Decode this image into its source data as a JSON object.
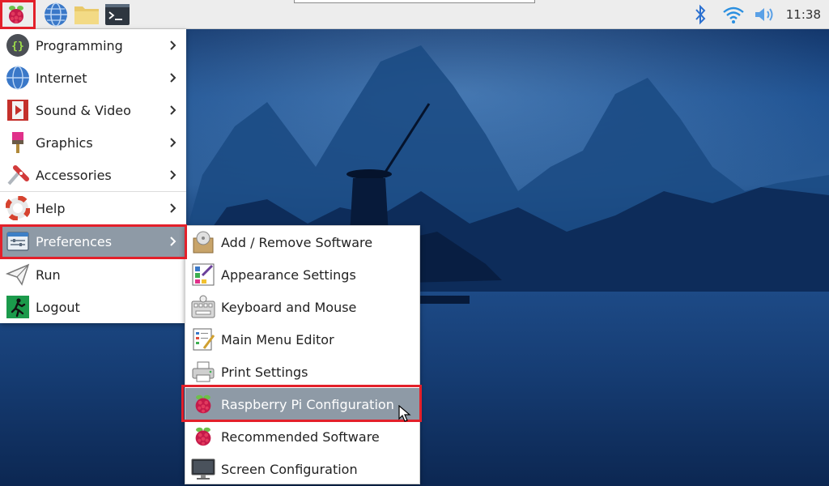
{
  "panel": {
    "clock": "11:38",
    "icons": [
      "raspberry-menu-icon",
      "web-browser-icon",
      "file-manager-icon",
      "terminal-icon"
    ],
    "tray_icons": [
      "bluetooth-icon",
      "wifi-icon",
      "volume-icon"
    ]
  },
  "main_menu": {
    "items": [
      {
        "label": "Programming",
        "icon": "programming-icon"
      },
      {
        "label": "Internet",
        "icon": "internet-icon"
      },
      {
        "label": "Sound & Video",
        "icon": "sound-video-icon"
      },
      {
        "label": "Graphics",
        "icon": "graphics-icon"
      },
      {
        "label": "Accessories",
        "icon": "accessories-icon"
      },
      {
        "label": "Help",
        "icon": "help-icon"
      },
      {
        "label": "Preferences",
        "icon": "preferences-icon",
        "selected": true
      },
      {
        "label": "Run",
        "icon": "run-icon"
      },
      {
        "label": "Logout",
        "icon": "logout-icon"
      }
    ]
  },
  "preferences_menu": {
    "items": [
      {
        "label": "Add / Remove Software",
        "icon": "add-remove-software-icon"
      },
      {
        "label": "Appearance Settings",
        "icon": "appearance-settings-icon"
      },
      {
        "label": "Keyboard and Mouse",
        "icon": "keyboard-mouse-icon"
      },
      {
        "label": "Main Menu Editor",
        "icon": "menu-editor-icon"
      },
      {
        "label": "Print Settings",
        "icon": "printer-icon"
      },
      {
        "label": "Raspberry Pi Configuration",
        "icon": "raspberry-pi-icon",
        "selected": true
      },
      {
        "label": "Recommended Software",
        "icon": "raspberry-pi-icon"
      },
      {
        "label": "Screen Configuration",
        "icon": "monitor-icon"
      }
    ]
  },
  "colors": {
    "highlight_border": "#e3202a",
    "selected_item_bg": "#8e9aa6",
    "raspberry_red": "#c51a4a",
    "leaf_green": "#6cc04a"
  }
}
